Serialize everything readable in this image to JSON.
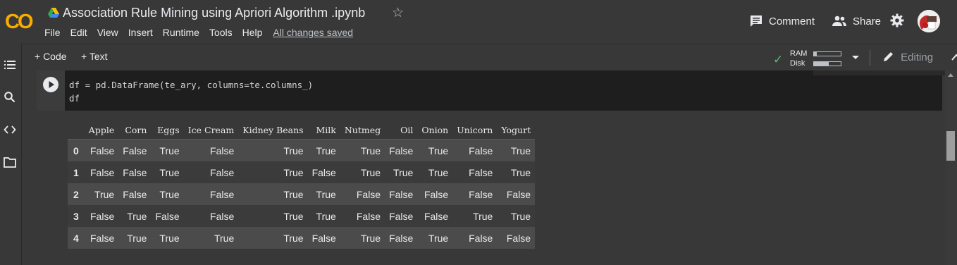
{
  "header": {
    "logo_text": "CO",
    "title": "Association Rule Mining using Apriori Algorithm .ipynb",
    "menu": [
      "File",
      "Edit",
      "View",
      "Insert",
      "Runtime",
      "Tools",
      "Help"
    ],
    "save_status": "All changes saved",
    "comment_label": "Comment",
    "share_label": "Share"
  },
  "toolbar": {
    "add_code": "+ Code",
    "add_text": "+ Text",
    "ram_label": "RAM",
    "disk_label": "Disk",
    "ram_usage_fraction": 0.1,
    "disk_usage_fraction": 0.55,
    "mode_label": "Editing"
  },
  "cell": {
    "code_line_1": "df = pd.DataFrame(te_ary, columns=te.columns_)",
    "code_line_2": "df"
  },
  "dataframe": {
    "columns": [
      "Apple",
      "Corn",
      "Eggs",
      "Ice Cream",
      "Kidney Beans",
      "Milk",
      "Nutmeg",
      "Oil",
      "Onion",
      "Unicorn",
      "Yogurt"
    ],
    "rows": [
      {
        "index": "0",
        "values": [
          "False",
          "False",
          "True",
          "False",
          "True",
          "True",
          "True",
          "False",
          "True",
          "False",
          "True"
        ]
      },
      {
        "index": "1",
        "values": [
          "False",
          "False",
          "True",
          "False",
          "True",
          "False",
          "True",
          "True",
          "True",
          "False",
          "True"
        ]
      },
      {
        "index": "2",
        "values": [
          "True",
          "False",
          "True",
          "False",
          "True",
          "True",
          "False",
          "False",
          "False",
          "False",
          "False"
        ]
      },
      {
        "index": "3",
        "values": [
          "False",
          "True",
          "False",
          "False",
          "True",
          "True",
          "False",
          "False",
          "False",
          "True",
          "True"
        ]
      },
      {
        "index": "4",
        "values": [
          "False",
          "True",
          "True",
          "True",
          "True",
          "False",
          "True",
          "False",
          "True",
          "False",
          "False"
        ]
      }
    ]
  },
  "colors": {
    "brand_orange": "#f9ab00",
    "background": "#383838",
    "editor_bg": "#1e1e1e",
    "check_green": "#5bb974"
  }
}
